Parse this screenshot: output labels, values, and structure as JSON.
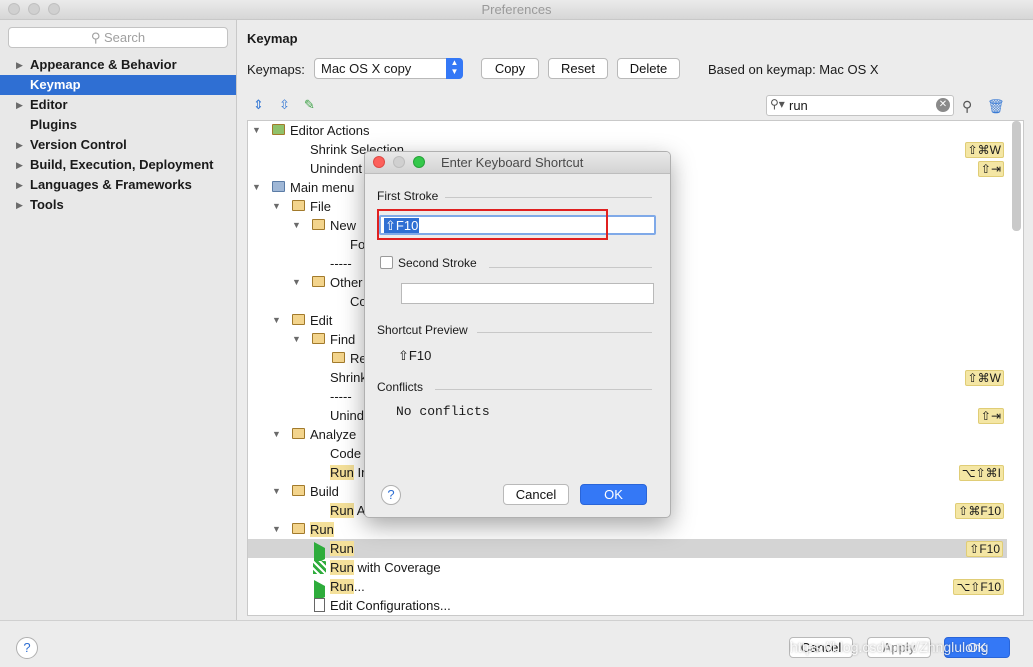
{
  "window": {
    "title": "Preferences"
  },
  "sidebar": {
    "search_placeholder": "Search",
    "items": [
      {
        "label": "Appearance & Behavior",
        "arrow": "▶"
      },
      {
        "label": "Keymap",
        "arrow": ""
      },
      {
        "label": "Editor",
        "arrow": "▶"
      },
      {
        "label": "Plugins",
        "arrow": ""
      },
      {
        "label": "Version Control",
        "arrow": "▶"
      },
      {
        "label": "Build, Execution, Deployment",
        "arrow": "▶"
      },
      {
        "label": "Languages & Frameworks",
        "arrow": "▶"
      },
      {
        "label": "Tools",
        "arrow": "▶"
      }
    ]
  },
  "keymap": {
    "heading": "Keymap",
    "keymaps_label": "Keymaps:",
    "selected_keymap": "Mac OS X copy",
    "copy_label": "Copy",
    "reset_label": "Reset",
    "delete_label": "Delete",
    "based_on": "Based on keymap: Mac OS X",
    "filter_value": "run"
  },
  "tree": {
    "rows": [
      {
        "text": "Editor Actions",
        "shortcut": ""
      },
      {
        "text": "Shrink Selection",
        "shortcut": "⇧⌘W"
      },
      {
        "text": "Unindent",
        "shortcut": "⇧⇥"
      },
      {
        "text": "Main menu",
        "shortcut": ""
      },
      {
        "text": "File",
        "shortcut": ""
      },
      {
        "text": "New",
        "shortcut": ""
      },
      {
        "text": "Fo",
        "shortcut": ""
      },
      {
        "text": "-----",
        "shortcut": ""
      },
      {
        "text": "Other",
        "shortcut": ""
      },
      {
        "text": "Co",
        "shortcut": ""
      },
      {
        "text": "Edit",
        "shortcut": ""
      },
      {
        "text": "Find",
        "shortcut": ""
      },
      {
        "text": "Re",
        "shortcut": ""
      },
      {
        "text": "Shrink",
        "shortcut": "⇧⌘W"
      },
      {
        "text": "-----",
        "shortcut": ""
      },
      {
        "text": "Unind",
        "shortcut": "⇧⇥"
      },
      {
        "text": "Analyze",
        "shortcut": ""
      },
      {
        "text": "Code",
        "shortcut": ""
      },
      {
        "hl": "Run",
        "text": " In",
        "shortcut": "⌥⇧⌘I"
      },
      {
        "text": "Build",
        "shortcut": ""
      },
      {
        "hl": "Run",
        "text": " A",
        "shortcut": "⇧⌘F10"
      },
      {
        "hl": "Run",
        "text": "",
        "shortcut": ""
      },
      {
        "hl": "Run",
        "text": "",
        "shortcut": "⇧F10"
      },
      {
        "hl": "Run",
        "text": " with Coverage",
        "shortcut": ""
      },
      {
        "hl": "Run",
        "text": "...",
        "shortcut": "⌥⇧F10"
      },
      {
        "text": "Edit Configurations...",
        "shortcut": ""
      }
    ]
  },
  "dialog": {
    "title": "Enter Keyboard Shortcut",
    "first_stroke_label": "First Stroke",
    "first_stroke_value": "⇧F10",
    "second_stroke_label": "Second Stroke",
    "second_stroke_value": "",
    "preview_label": "Shortcut Preview",
    "preview_value": "⇧F10",
    "conflicts_label": "Conflicts",
    "conflicts_value": "No conflicts",
    "help_label": "?",
    "cancel_label": "Cancel",
    "ok_label": "OK",
    "highlight_color": "#e02020"
  },
  "footer": {
    "help_label": "?",
    "cancel_label": "Cancel",
    "apply_label": "Apply",
    "ok_label": "OK",
    "watermark": "https://blog.csdn.net/Zhnglulong"
  }
}
